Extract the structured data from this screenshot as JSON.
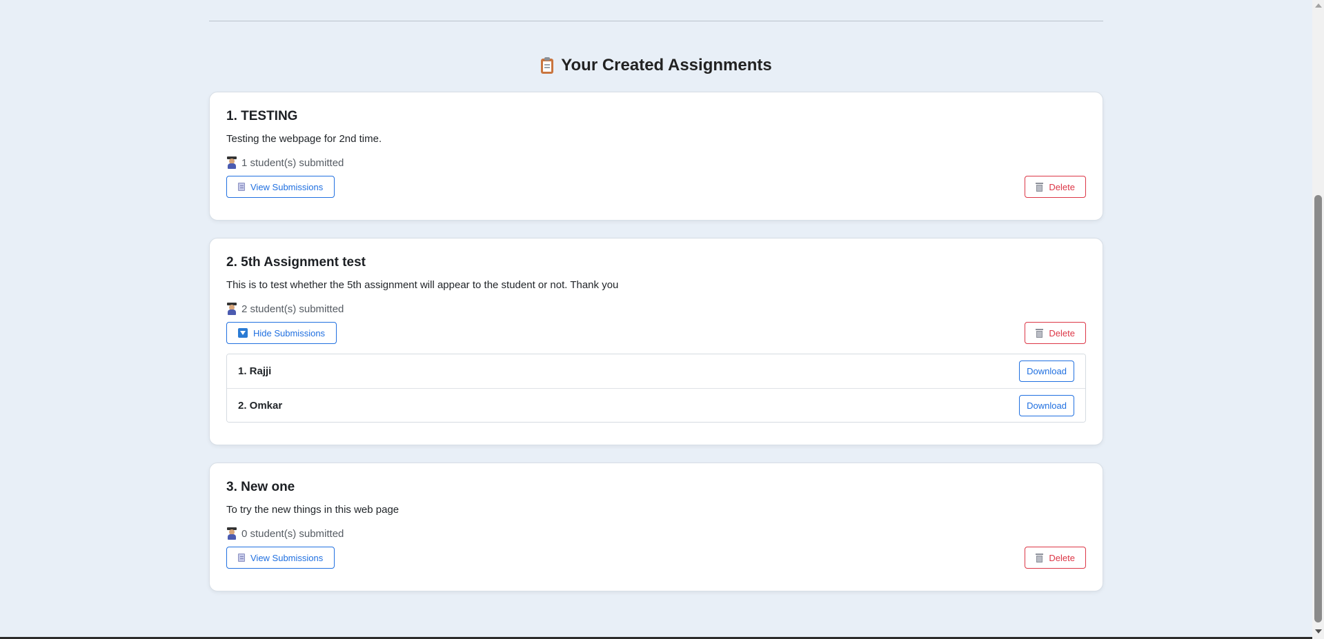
{
  "section": {
    "title": "Your Created Assignments",
    "icon": "clipboard-icon"
  },
  "assignments": [
    {
      "title": "1. TESTING",
      "description": "Testing the webpage for 2nd time.",
      "count": "1 student(s) submitted",
      "toggle_label": "View Submissions",
      "toggle_icon": "document-icon",
      "delete_label": "Delete"
    },
    {
      "title": "2. 5th Assignment test",
      "description": "This is to test whether the 5th assignment will appear to the student or not. Thank you",
      "count": "2 student(s) submitted",
      "toggle_label": "Hide Submissions",
      "toggle_icon": "triangle-down-icon",
      "delete_label": "Delete",
      "submissions": [
        {
          "name": "1. Rajji",
          "action": "Download"
        },
        {
          "name": "2. Omkar",
          "action": "Download"
        }
      ]
    },
    {
      "title": "3. New one",
      "description": "To try the new things in this web page",
      "count": "0 student(s) submitted",
      "toggle_label": "View Submissions",
      "toggle_icon": "document-icon",
      "delete_label": "Delete"
    }
  ],
  "colors": {
    "background": "#e8eff7",
    "primary": "#1f6fe0",
    "danger": "#dc3545"
  }
}
